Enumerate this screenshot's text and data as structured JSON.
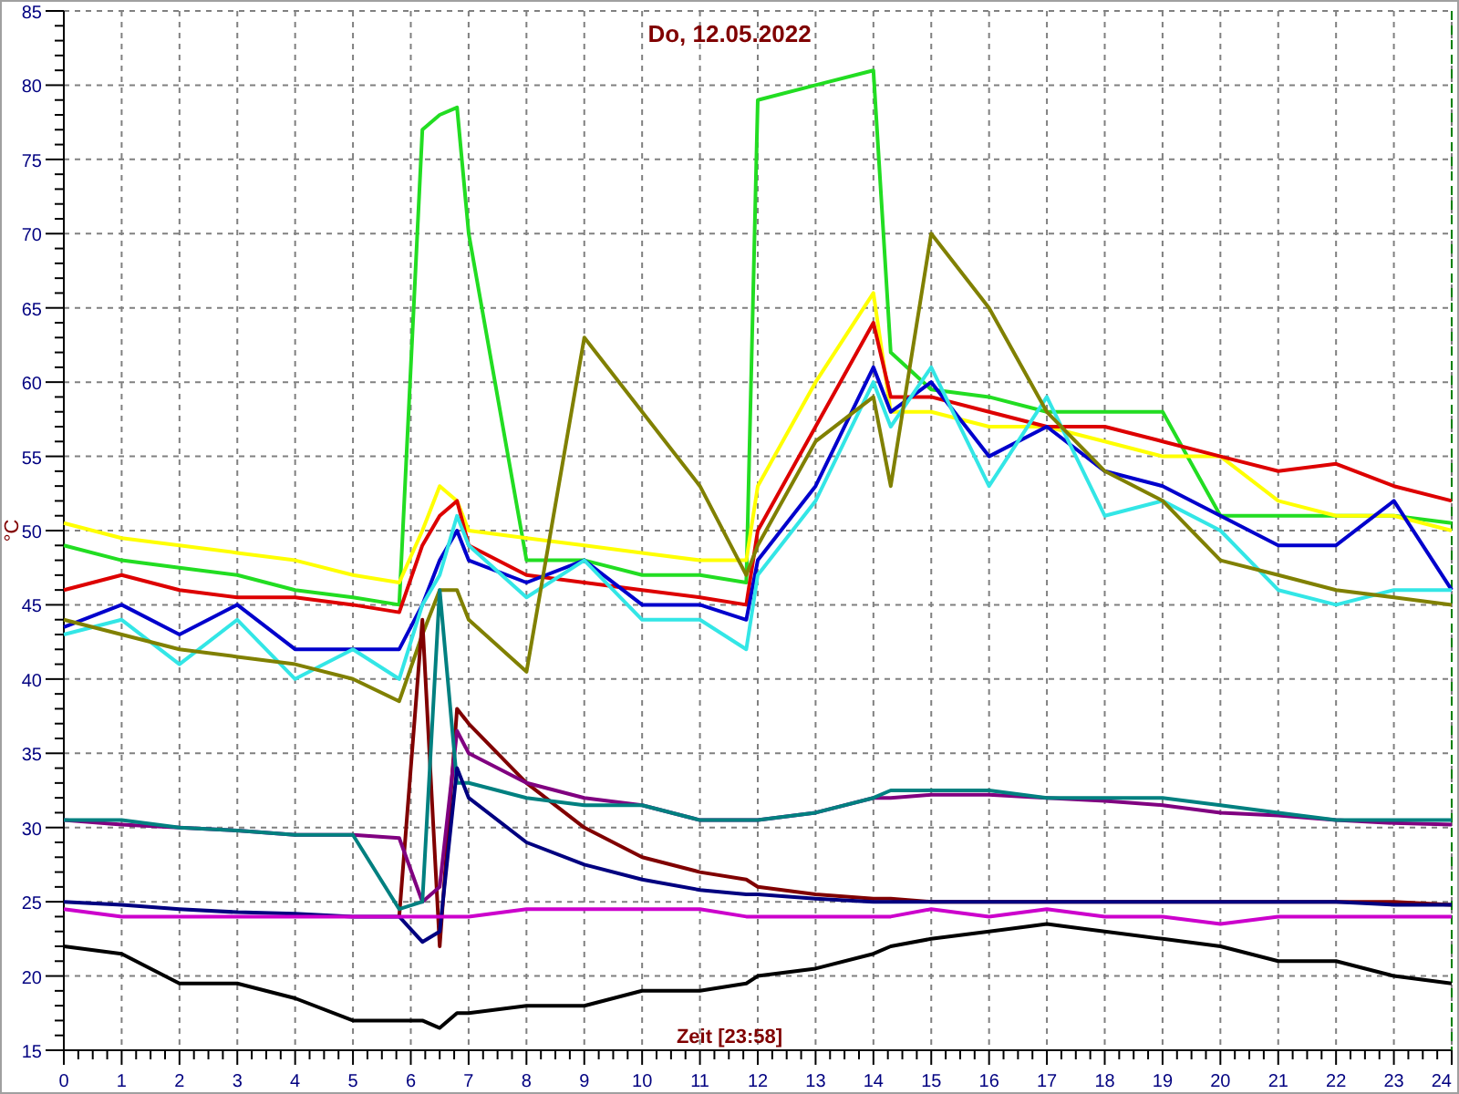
{
  "chart_data": {
    "type": "line",
    "title": "Do, 12.05.2022",
    "xlabel": "Zeit [23:58]",
    "ylabel": "°C",
    "x": [
      0,
      1,
      2,
      3,
      4,
      5,
      5.8,
      6.2,
      6.5,
      6.8,
      7,
      8,
      9,
      10,
      11,
      11.8,
      12,
      13,
      14,
      14.3,
      15,
      16,
      17,
      18,
      19,
      20,
      21,
      22,
      23,
      24
    ],
    "series": [
      {
        "color": "#22dd22",
        "values": [
          49,
          48,
          47.5,
          47,
          46,
          45.5,
          45,
          77,
          78,
          78.5,
          70,
          48,
          48,
          47,
          47,
          46.5,
          79,
          80,
          81,
          62,
          59.5,
          59,
          58,
          58,
          58,
          51,
          51,
          51,
          51,
          50.5
        ]
      },
      {
        "color": "#ffff00",
        "values": [
          50.5,
          49.5,
          49,
          48.5,
          48,
          47,
          46.5,
          50,
          53,
          52,
          50,
          49.5,
          49,
          48.5,
          48,
          48,
          53,
          60,
          66,
          58,
          58,
          57,
          57,
          56,
          55,
          55,
          52,
          51,
          51,
          50
        ]
      },
      {
        "color": "#dd0000",
        "values": [
          46,
          47,
          46,
          45.5,
          45.5,
          45,
          44.5,
          49,
          51,
          52,
          49,
          47,
          46.5,
          46,
          45.5,
          45,
          50,
          57,
          64,
          59,
          59,
          58,
          57,
          57,
          56,
          55,
          54,
          54.5,
          53,
          52
        ]
      },
      {
        "color": "#0000cc",
        "values": [
          43.5,
          45,
          43,
          45,
          42,
          42,
          42,
          45,
          48,
          50,
          48,
          46.5,
          48,
          45,
          45,
          44,
          48,
          53,
          61,
          58,
          60,
          55,
          57,
          54,
          53,
          51,
          49,
          49,
          52,
          46
        ]
      },
      {
        "color": "#33e6e6",
        "values": [
          43,
          44,
          41,
          44,
          40,
          42,
          40,
          45,
          47,
          51,
          49,
          45.5,
          48,
          44,
          44,
          42,
          47,
          52,
          60,
          57,
          61,
          53,
          59,
          51,
          52,
          50,
          46,
          45,
          46,
          46
        ]
      },
      {
        "color": "#808000",
        "values": [
          44,
          43,
          42,
          41.5,
          41,
          40,
          38.5,
          43,
          46,
          46,
          44,
          40.5,
          63,
          58,
          53,
          47,
          49,
          56,
          59,
          53,
          70,
          65,
          58,
          54,
          52,
          48,
          47,
          46,
          45.5,
          45
        ]
      },
      {
        "color": "#800000",
        "values": [
          null,
          null,
          null,
          null,
          null,
          null,
          24,
          44,
          22,
          38,
          37,
          33,
          30,
          28,
          27,
          26.5,
          26,
          25.5,
          25.2,
          25.2,
          25,
          25,
          25,
          25,
          25,
          25,
          25,
          25,
          25,
          24.8
        ]
      },
      {
        "color": "#800080",
        "values": [
          30.5,
          30.2,
          30,
          29.8,
          29.5,
          29.5,
          29.3,
          25,
          26,
          36.5,
          35,
          33,
          32,
          31.5,
          30.5,
          30.5,
          30.5,
          31,
          32,
          32,
          32.2,
          32.2,
          32,
          31.8,
          31.5,
          31,
          30.8,
          30.5,
          30.3,
          30.2
        ]
      },
      {
        "color": "#008080",
        "values": [
          30.5,
          30.5,
          30,
          29.8,
          29.5,
          29.5,
          24.5,
          25,
          46,
          33,
          33,
          32,
          31.5,
          31.5,
          30.5,
          30.5,
          30.5,
          31,
          32,
          32.5,
          32.5,
          32.5,
          32,
          32,
          32,
          31.5,
          31,
          30.5,
          30.5,
          30.5
        ]
      },
      {
        "color": "#000080",
        "values": [
          25,
          24.8,
          24.5,
          24.3,
          24.2,
          24,
          24,
          22.3,
          23,
          34,
          32,
          29,
          27.5,
          26.5,
          25.8,
          25.5,
          25.5,
          25.2,
          25,
          25,
          25,
          25,
          25,
          25,
          25,
          25,
          25,
          25,
          24.8,
          24.8
        ]
      },
      {
        "color": "#cc00cc",
        "values": [
          24.5,
          24,
          24,
          24,
          24,
          24,
          24,
          24,
          24,
          24,
          24,
          24.5,
          24.5,
          24.5,
          24.5,
          24,
          24,
          24,
          24,
          24,
          24.5,
          24,
          24.5,
          24,
          24,
          23.5,
          24,
          24,
          24,
          24
        ]
      },
      {
        "color": "#000000",
        "values": [
          22,
          21.5,
          19.5,
          19.5,
          18.5,
          17,
          17,
          17,
          16.5,
          17.5,
          17.5,
          18,
          18,
          19,
          19,
          19.5,
          20,
          20.5,
          21.5,
          22,
          22.5,
          23,
          23.5,
          23,
          22.5,
          22,
          21,
          21,
          20,
          19.5
        ]
      }
    ],
    "grid": true,
    "xlim": [
      0,
      24
    ],
    "ylim": [
      15,
      85
    ],
    "xticks": [
      0,
      1,
      2,
      3,
      4,
      5,
      6,
      7,
      8,
      9,
      10,
      11,
      12,
      13,
      14,
      15,
      16,
      17,
      18,
      19,
      20,
      21,
      22,
      23,
      24
    ],
    "yticks": [
      15,
      20,
      25,
      30,
      35,
      40,
      45,
      50,
      55,
      60,
      65,
      70,
      75,
      80,
      85
    ]
  }
}
